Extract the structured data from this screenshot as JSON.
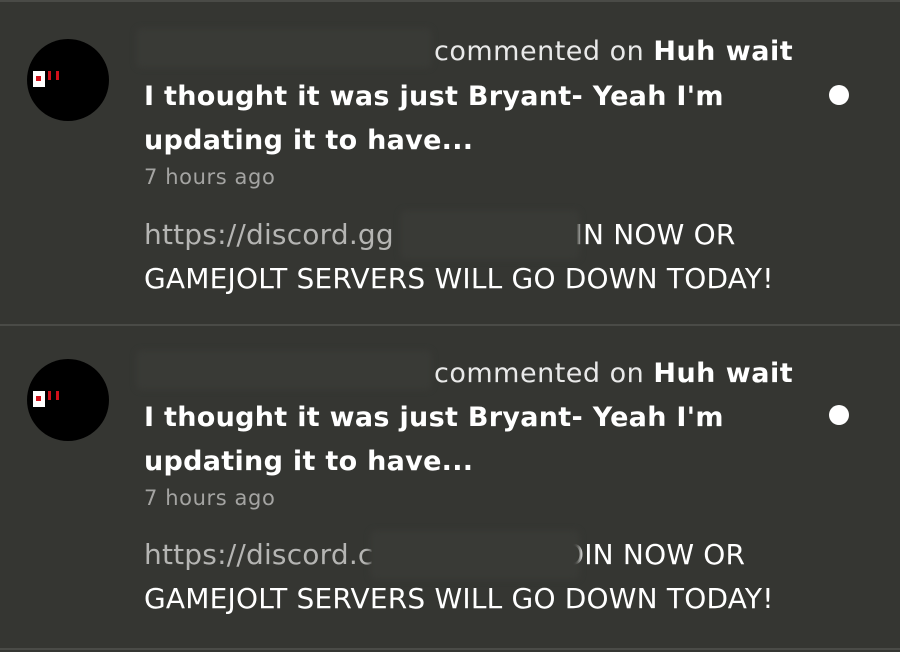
{
  "colors": {
    "background": "#353632",
    "divider": "#4a4b47",
    "primary_text": "#ffffff",
    "secondary_text": "#a4a4a2",
    "link_text": "#b5b5b3",
    "avatar_bg": "#000000",
    "avatar_accent": "#d0101a",
    "unread_dot": "#ffffff"
  },
  "notifications": [
    {
      "avatar_icon": "user-avatar-icon",
      "action": "commented on",
      "target": "Huh wait",
      "title": "I thought it was just Bryant- Yeah I'm updating it to have...",
      "time": "7 hours ago",
      "link_fragment": "https://discord.gg",
      "body_tail": "JOIN NOW OR",
      "body_line2": "GAMEJOLT SERVERS WILL GO DOWN TODAY!",
      "unread": true
    },
    {
      "avatar_icon": "user-avatar-icon",
      "action": "commented on",
      "target": "Huh wait",
      "title": "I thought it was just Bryant- Yeah I'm updating it to have...",
      "time": "7 hours ago",
      "link_fragment": "https://discord.c",
      "body_tail": "JOIN NOW OR",
      "body_line2": "GAMEJOLT SERVERS WILL GO DOWN TODAY!",
      "unread": true
    }
  ]
}
